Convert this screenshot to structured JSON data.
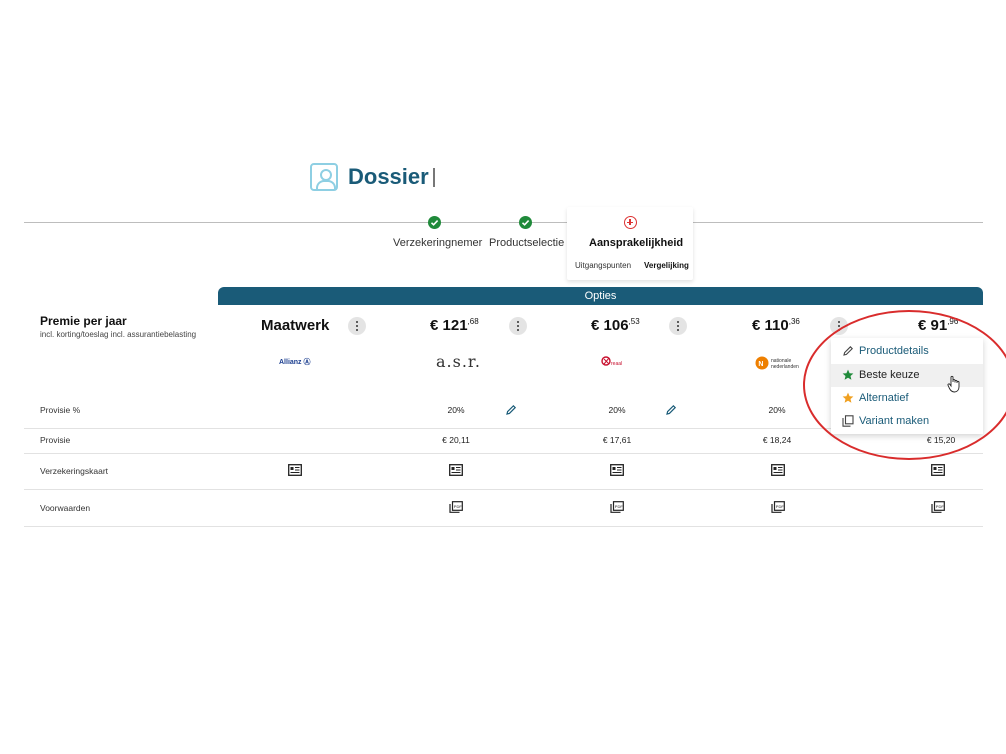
{
  "header": {
    "title": "Dossier",
    "icon": "person-badge-icon"
  },
  "stepper": {
    "steps": [
      {
        "label": "Verzekeringnemer",
        "status": "done"
      },
      {
        "label": "Productselectie",
        "status": "done"
      },
      {
        "label": "Aansprakelijkheid",
        "status": "active"
      }
    ],
    "substeps": [
      "Uitgangspunten",
      "Vergelijking"
    ]
  },
  "table": {
    "banner": "Opties",
    "premie_title": "Premie per jaar",
    "premie_subtitle": "incl. korting/toeslag incl. assurantiebelasting",
    "columns": [
      {
        "head": "Maatwerk",
        "logo": "Allianz Ⓐ",
        "provisie_pct": "",
        "provisie": "",
        "has_voorwaarden": false
      },
      {
        "head_main": "€ 121",
        "head_cents": ",68",
        "logo": "a.s.r.",
        "provisie_pct": "20%",
        "provisie": "€ 20,11"
      },
      {
        "head_main": "€ 106",
        "head_cents": ",53",
        "logo": "reaal",
        "provisie_pct": "20%",
        "provisie": "€ 17,61"
      },
      {
        "head_main": "€ 110",
        "head_cents": ",36",
        "logo": "nationale nederlanden",
        "provisie_pct": "20%",
        "provisie": "€ 18,24"
      },
      {
        "head_main": "€ 91",
        "head_cents": ",96",
        "provisie": "€ 15,20"
      }
    ],
    "row_labels": {
      "provisie_pct": "Provisie %",
      "provisie": "Provisie",
      "kaart": "Verzekeringskaart",
      "voorwaarden": "Voorwaarden"
    }
  },
  "menu": {
    "items": [
      {
        "label": "Productdetails",
        "icon": "pencil-icon"
      },
      {
        "label": "Beste keuze",
        "icon": "star-icon",
        "color": "#1f8a3a"
      },
      {
        "label": "Alternatief",
        "icon": "star-icon",
        "color": "#f0a020"
      },
      {
        "label": "Variant maken",
        "icon": "copy-icon"
      }
    ]
  },
  "colors": {
    "brand": "#1a5b78",
    "done": "#1f8a3a",
    "active": "#d33333",
    "highlight": "#d92c2c"
  }
}
